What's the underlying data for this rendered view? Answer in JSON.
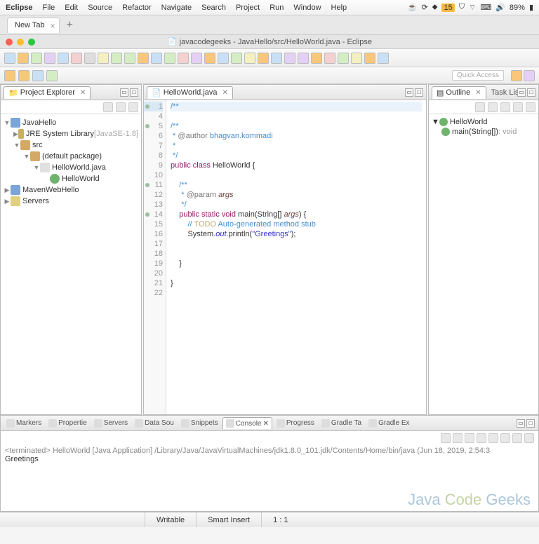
{
  "menubar": {
    "app": "Eclipse",
    "items": [
      "File",
      "Edit",
      "Source",
      "Refactor",
      "Navigate",
      "Search",
      "Project",
      "Run",
      "Window",
      "Help"
    ],
    "battery": "89%",
    "notif": "15"
  },
  "browserTab": {
    "label": "New Tab"
  },
  "window": {
    "title": "javacodegeeks - JavaHello/src/HelloWorld.java - Eclipse",
    "quickAccess": "Quick Access"
  },
  "projectExplorer": {
    "title": "Project Explorer",
    "tree": [
      {
        "lvl": 0,
        "tw": "▼",
        "ic": "fold",
        "label": "JavaHello"
      },
      {
        "lvl": 1,
        "tw": "▶",
        "ic": "jar",
        "label": "JRE System Library ",
        "extra": "[JavaSE-1.8]"
      },
      {
        "lvl": 1,
        "tw": "▼",
        "ic": "pkg",
        "label": "src"
      },
      {
        "lvl": 2,
        "tw": "▼",
        "ic": "pkg",
        "label": "(default package)"
      },
      {
        "lvl": 3,
        "tw": "▼",
        "ic": "file",
        "label": "HelloWorld.java"
      },
      {
        "lvl": 4,
        "tw": "",
        "ic": "cls",
        "label": "HelloWorld"
      },
      {
        "lvl": 0,
        "tw": "▶",
        "ic": "fold",
        "label": "MavenWebHello"
      },
      {
        "lvl": 0,
        "tw": "▶",
        "ic": "srv",
        "label": "Servers"
      }
    ]
  },
  "editor": {
    "tab": "HelloWorld.java",
    "lines": [
      {
        "n": 1,
        "hl": true,
        "mark": true,
        "html": "<span class='cm'>/**</span>"
      },
      {
        "n": 4,
        "html": ""
      },
      {
        "n": 5,
        "mark": true,
        "html": "<span class='cm'>/**</span>"
      },
      {
        "n": 6,
        "html": "<span class='cm'> * </span><span class='ann'>@author</span><span class='cm'> bhagvan.kommadi</span>"
      },
      {
        "n": 7,
        "html": "<span class='cm'> *</span>"
      },
      {
        "n": 8,
        "html": "<span class='cm'> */</span>"
      },
      {
        "n": 9,
        "html": "<span class='kw'>public class</span> <span class='id'>HelloWorld</span> {"
      },
      {
        "n": 10,
        "html": ""
      },
      {
        "n": 11,
        "mark": true,
        "html": "    <span class='cm'>/**</span>"
      },
      {
        "n": 12,
        "html": "    <span class='cm'> * </span><span class='ann'>@param</span> <span class='var'>args</span>"
      },
      {
        "n": 13,
        "html": "    <span class='cm'> */</span>"
      },
      {
        "n": 14,
        "mark": true,
        "html": "    <span class='kw'>public static</span> <span class='kw'>void</span> <span class='id'>main</span>(<span class='id'>String</span>[] <span class='var'>args</span>) {"
      },
      {
        "n": 15,
        "html": "        <span class='cm'>// </span><span class='todo'>TODO</span><span class='cm'> Auto-generated method stub</span>"
      },
      {
        "n": 16,
        "html": "        <span class='id'>System</span>.<span class='fld'>out</span>.<span class='id'>println</span>(<span class='str'>\"Greetings\"</span>);"
      },
      {
        "n": 17,
        "html": ""
      },
      {
        "n": 18,
        "html": ""
      },
      {
        "n": 19,
        "html": "    }"
      },
      {
        "n": 20,
        "html": ""
      },
      {
        "n": 21,
        "html": "}"
      },
      {
        "n": 22,
        "html": ""
      }
    ]
  },
  "outline": {
    "title": "Outline",
    "taskList": "Task List",
    "items": [
      {
        "lvl": 0,
        "tw": "▼",
        "ic": "cls",
        "label": "HelloWorld"
      },
      {
        "lvl": 1,
        "tw": "",
        "ic": "meth",
        "label": "main(String[])",
        "ret": " : void"
      }
    ]
  },
  "bottomTabs": [
    "Markers",
    "Propertie",
    "Servers",
    "Data Sou",
    "Snippets",
    "Console",
    "Progress",
    "Gradle Ta",
    "Gradle Ex"
  ],
  "bottomActive": 5,
  "console": {
    "header": "<terminated> HelloWorld [Java Application] /Library/Java/JavaVirtualMachines/jdk1.8.0_101.jdk/Contents/Home/bin/java (Jun 18, 2019, 2:54:3",
    "output": "Greetings"
  },
  "statusBar": {
    "writable": "Writable",
    "insert": "Smart Insert",
    "pos": "1 : 1"
  },
  "watermark": {
    "t1": "Java ",
    "t2": "Code ",
    "t3": "Geeks"
  }
}
